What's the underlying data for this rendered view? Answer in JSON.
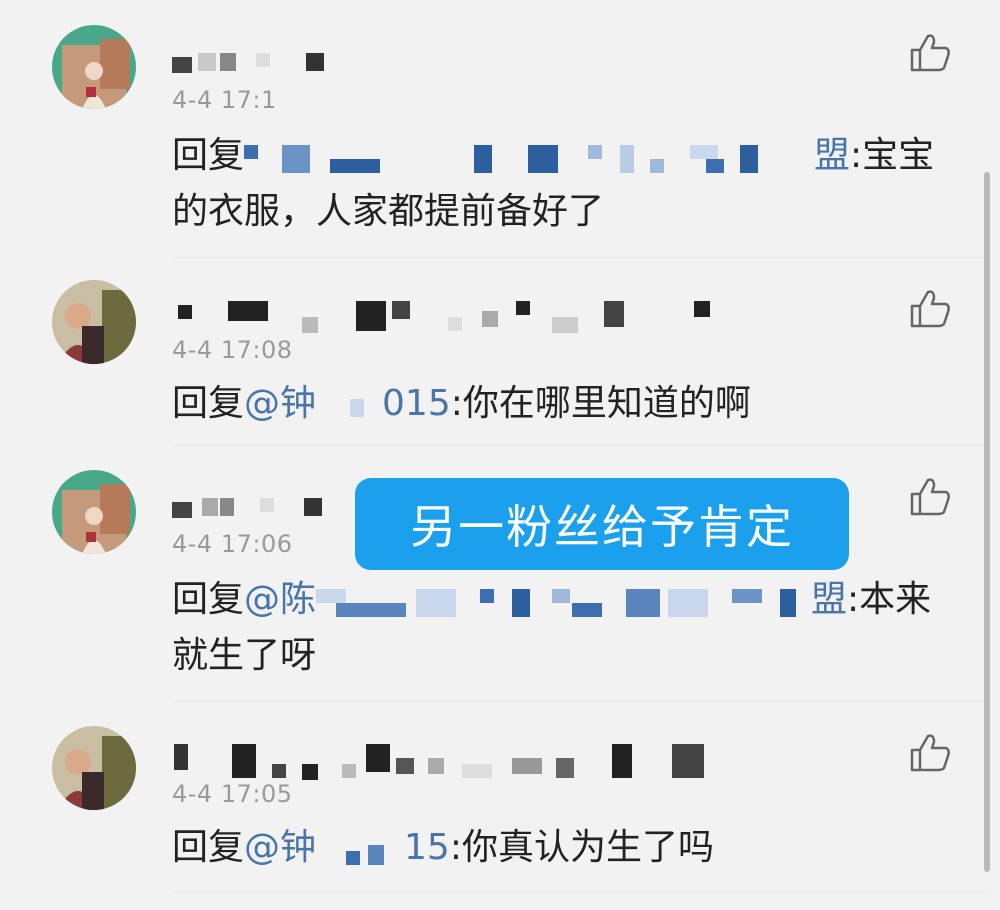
{
  "comments": [
    {
      "avatar": "green-avatar",
      "time": "4-4 17:1",
      "reply_prefix": "回复",
      "mention_tail": "盟",
      "text": ":宝宝的衣服，人家都提前备好了"
    },
    {
      "avatar": "brown-avatar",
      "time": "4-4 17:08",
      "reply_prefix": "回复",
      "mention_head": "@钟",
      "mention_tail": "015",
      "text": ":你在哪里知道的啊"
    },
    {
      "avatar": "green-avatar",
      "time": "4-4 17:06",
      "reply_prefix": "回复",
      "mention_head": "@陈",
      "mention_tail": "盟",
      "text": ":本来就生了呀"
    },
    {
      "avatar": "brown-avatar",
      "time": "4-4 17:05",
      "reply_prefix": "回复",
      "mention_head": "@钟",
      "mention_tail": "15",
      "text": ":你真认为生了吗"
    }
  ],
  "overlay": {
    "label": "另一粉丝给予肯定"
  },
  "icons": {
    "like": "thumbs-up-icon",
    "avatar_bg_green": "#4aa88a"
  },
  "colors": {
    "mention": "#4a75a8",
    "overlay": "#1aa0ec"
  }
}
